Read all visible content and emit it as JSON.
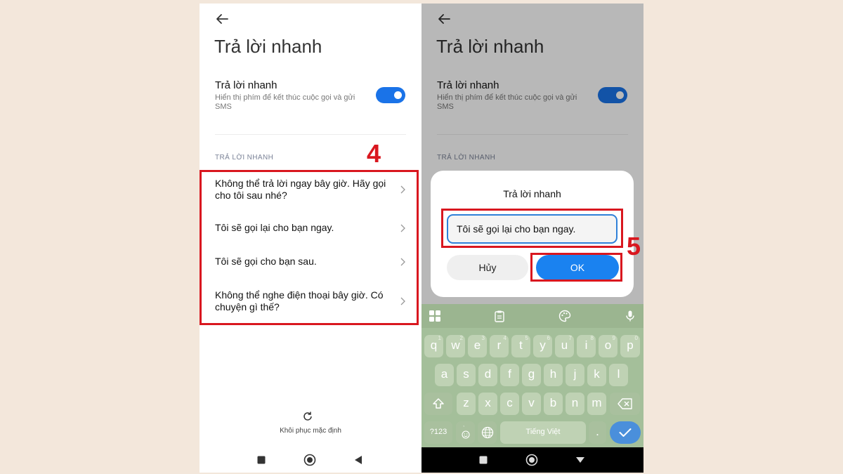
{
  "left_screen": {
    "title": "Trả lời nhanh",
    "setting": {
      "title": "Trả lời nhanh",
      "description": "Hiển thị phím để kết thúc cuộc gọi và gửi SMS",
      "enabled": true
    },
    "section_header": "TRẢ LỜI NHANH",
    "replies": [
      "Không thể trả lời ngay bây giờ. Hãy gọi cho tôi sau nhé?",
      "Tôi sẽ gọi lại cho bạn ngay.",
      "Tôi sẽ gọi cho bạn sau.",
      "Không thể nghe điện thoại bây giờ. Có chuyện gì thế?"
    ],
    "restore_label": "Khôi phục mặc định"
  },
  "right_screen": {
    "title": "Trả lời nhanh",
    "setting": {
      "title": "Trả lời nhanh",
      "description": "Hiển thị phím để kết thúc cuộc gọi và gửi SMS"
    },
    "section_header": "TRẢ LỜI NHANH",
    "dialog": {
      "title": "Trả lời nhanh",
      "input_value": "Tôi sẽ gọi lại cho bạn ngay.",
      "cancel_label": "Hủy",
      "ok_label": "OK"
    },
    "keyboard": {
      "row1": [
        "q",
        "w",
        "e",
        "r",
        "t",
        "y",
        "u",
        "i",
        "o",
        "p"
      ],
      "row1_hints": [
        "1",
        "2",
        "3",
        "4",
        "5",
        "6",
        "7",
        "8",
        "9",
        "0"
      ],
      "row2": [
        "a",
        "s",
        "d",
        "f",
        "g",
        "h",
        "j",
        "k",
        "l"
      ],
      "row3": [
        "z",
        "x",
        "c",
        "v",
        "b",
        "n",
        "m"
      ],
      "symbols_key": "?123",
      "emoji_hint": ",",
      "period_key": ".",
      "space_label": "Tiếng Việt"
    }
  },
  "annotations": {
    "step_left": "4",
    "step_right": "5",
    "color": "#d9171f"
  },
  "colors": {
    "accent": "#1a73e8",
    "background": "#f3e7db"
  }
}
